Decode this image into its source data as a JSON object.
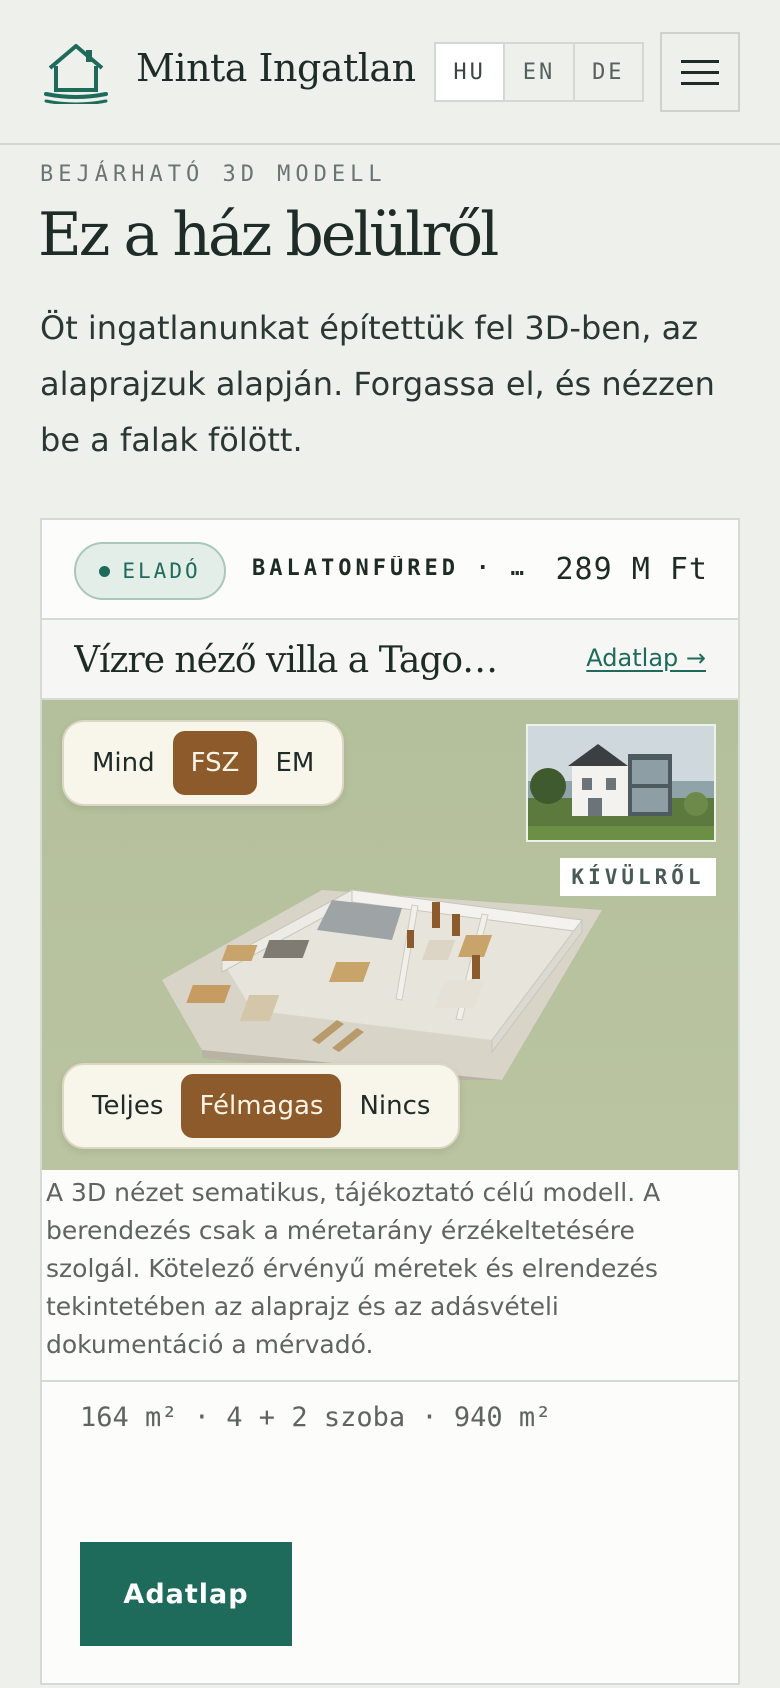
{
  "header": {
    "brand": "Minta Ingatlan",
    "languages": [
      "HU",
      "EN",
      "DE"
    ],
    "active_language": "HU"
  },
  "hero": {
    "eyebrow": "BEJÁRHATÓ 3D MODELL",
    "title": "Ez a ház belülről",
    "lead": "Öt ingatlanunkat építettük fel 3D-ben, az alaprajzuk alapján. Forgassa el, és nézzen be a falak fölött."
  },
  "listing": {
    "status": "ELADÓ",
    "location": "BALATONFÜRED · …",
    "price": "289 M Ft",
    "title": "Vízre néző villa a Tagore…",
    "datasheet_link": "Adatlap →",
    "floor_filter": {
      "options": [
        "Mind",
        "FSZ",
        "EM"
      ],
      "selected": "FSZ"
    },
    "wall_filter": {
      "options": [
        "Teljes",
        "Félmagas",
        "Nincs"
      ],
      "selected": "Félmagas"
    },
    "photo_label": "KÍVÜLRŐL",
    "disclaimer": "A 3D nézet sematikus, tájékoztató célú modell. A berendezés csak a méretarány érzékeltetésére szolgál. Kötelező érvényű méretek és elrendezés tekintetében az alaprajz és az adásvételi dokumentáció a mérvadó.",
    "specs": "164 m² · 4 + 2 szoba · 940 m²",
    "cta": "Adatlap"
  },
  "colors": {
    "accent": "#1e6b5c",
    "active_segment": "#8c5a2b",
    "viewer_bg": "#b8c39f",
    "page_bg": "#eef0ec"
  }
}
